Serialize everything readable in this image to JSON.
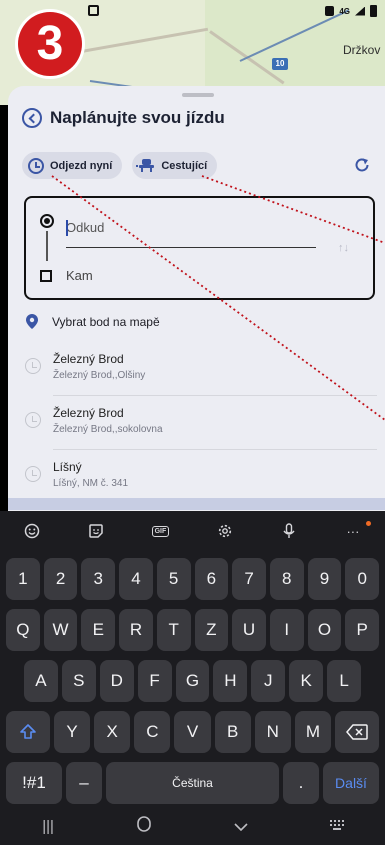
{
  "step_badge": "3",
  "map": {
    "road_shield": "10",
    "place_label": "Držkov"
  },
  "statusbar": {
    "icons": [
      "lock-icon",
      "network-4g-icon",
      "signal-icon",
      "battery-icon"
    ],
    "network": "4G"
  },
  "header": {
    "title": "Naplánujte svou jízdu",
    "back_icon": "back-arrow-icon"
  },
  "chips": {
    "departure": "Odjezd nyní",
    "passengers": "Cestující"
  },
  "route": {
    "from_placeholder": "Odkud",
    "to_label": "Kam"
  },
  "list": {
    "map_pick": "Vybrat bod na mapě",
    "history": [
      {
        "name": "Železný Brod",
        "sub": "Železný Brod,,Olšiny"
      },
      {
        "name": "Železný Brod",
        "sub": "Železný Brod,,sokolovna"
      },
      {
        "name": "Líšný",
        "sub": "Líšný, NM č. 341"
      }
    ]
  },
  "keyboard": {
    "numbers": [
      "1",
      "2",
      "3",
      "4",
      "5",
      "6",
      "7",
      "8",
      "9",
      "0"
    ],
    "row1": [
      "Q",
      "W",
      "E",
      "R",
      "T",
      "Z",
      "U",
      "I",
      "O",
      "P"
    ],
    "row2": [
      "A",
      "S",
      "D",
      "F",
      "G",
      "H",
      "J",
      "K",
      "L"
    ],
    "row3": [
      "Y",
      "X",
      "C",
      "V",
      "B",
      "N",
      "M"
    ],
    "symbols_key": "!#1",
    "dash_key": "–",
    "space_label": "Čeština",
    "dot_key": ".",
    "next_key": "Další",
    "gif_label": "GIF",
    "more_label": "···"
  },
  "colors": {
    "accent": "#3b56a5",
    "badge": "#d11c1f",
    "callout": "#c0121b"
  }
}
